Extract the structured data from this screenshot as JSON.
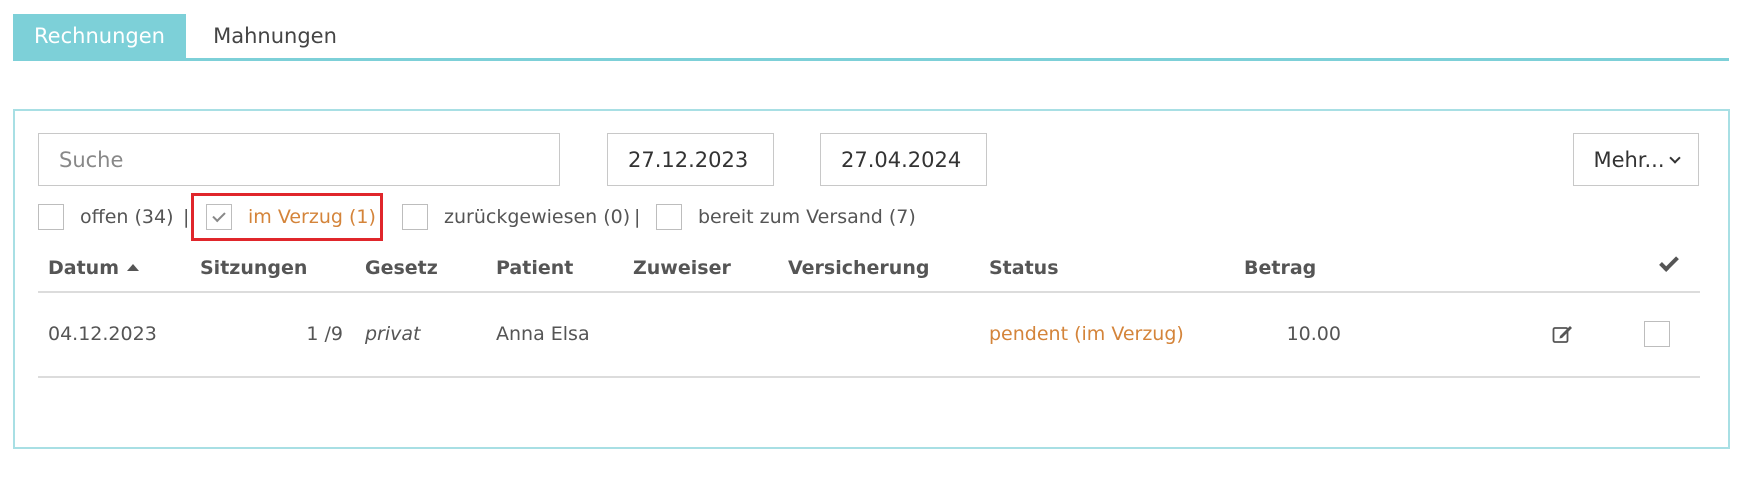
{
  "tabs": [
    {
      "label": "Rechnungen",
      "active": true
    },
    {
      "label": "Mahnungen",
      "active": false
    }
  ],
  "toolbar": {
    "search_placeholder": "Suche",
    "date_from": "27.12.2023",
    "date_to": "27.04.2024",
    "more_label": "Mehr..."
  },
  "filters": [
    {
      "label": "offen (34)",
      "checked": false
    },
    {
      "label": "im Verzug (1)",
      "checked": true
    },
    {
      "label": "zurückgewiesen (0)",
      "checked": false
    },
    {
      "label": "bereit zum Versand (7)",
      "checked": false
    }
  ],
  "separator": "|",
  "table": {
    "columns": [
      "Datum",
      "Sitzungen",
      "Gesetz",
      "Patient",
      "Zuweiser",
      "Versicherung",
      "Status",
      "Betrag"
    ],
    "rows": [
      {
        "datum": "04.12.2023",
        "sitzungen": "1 /9",
        "gesetz": "privat",
        "patient": "Anna Elsa",
        "zuweiser": "",
        "versicherung": "",
        "status": "pendent (im Verzug)",
        "betrag": "10.00",
        "checked": false
      }
    ]
  },
  "colors": {
    "accent": "#7dd0d8",
    "overdue": "#d4843a",
    "highlight": "#e0262b"
  }
}
